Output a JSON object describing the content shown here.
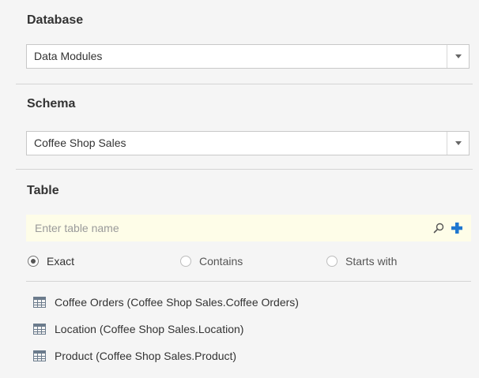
{
  "database": {
    "heading": "Database",
    "selected": "Data Modules"
  },
  "schema": {
    "heading": "Schema",
    "selected": "Coffee Shop Sales"
  },
  "table": {
    "heading": "Table",
    "search_placeholder": "Enter table name",
    "search_value": "",
    "match_options": [
      {
        "label": "Exact",
        "checked": true
      },
      {
        "label": "Contains",
        "checked": false
      },
      {
        "label": "Starts with",
        "checked": false
      }
    ],
    "items": [
      {
        "label": "Coffee Orders (Coffee Shop Sales.Coffee Orders)",
        "icon": "table-icon"
      },
      {
        "label": "Location (Coffee Shop Sales.Location)",
        "icon": "table-icon"
      },
      {
        "label": "Product (Coffee Shop Sales.Product)",
        "icon": "table-icon"
      }
    ]
  },
  "colors": {
    "panel_bg": "#f5f5f5",
    "search_bg": "#fefde8",
    "add_icon": "#1f77d0",
    "table_icon": "#6b7b8c"
  }
}
